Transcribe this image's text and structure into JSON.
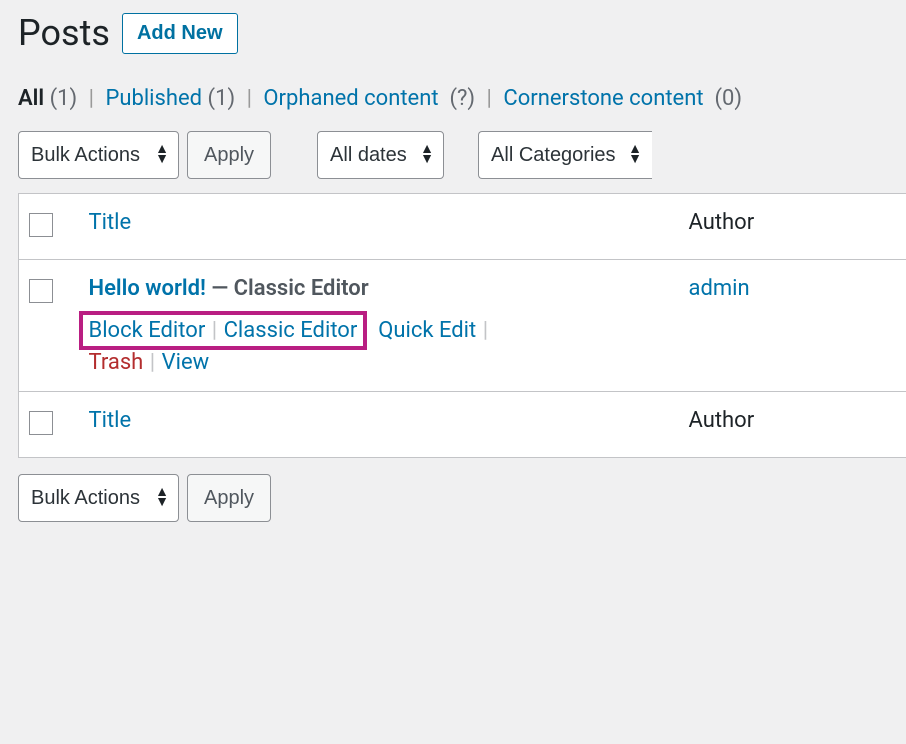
{
  "header": {
    "title": "Posts",
    "add_new": "Add New"
  },
  "filters": {
    "all_label": "All",
    "all_count": "(1)",
    "published_label": "Published",
    "published_count": "(1)",
    "orphaned_label": "Orphaned content",
    "orphaned_count": "(?)",
    "cornerstone_label": "Cornerstone content",
    "cornerstone_count": "(0)"
  },
  "tablenav": {
    "bulk_actions": "Bulk Actions",
    "apply": "Apply",
    "all_dates": "All dates",
    "all_categories": "All Categories"
  },
  "columns": {
    "title": "Title",
    "author": "Author"
  },
  "post": {
    "title": "Hello world!",
    "state_sep": " — ",
    "state": "Classic Editor",
    "actions": {
      "block_editor": "Block Editor",
      "classic_editor": "Classic Editor",
      "quick_edit": "Quick Edit",
      "trash": "Trash",
      "view": "View"
    },
    "author": "admin"
  }
}
